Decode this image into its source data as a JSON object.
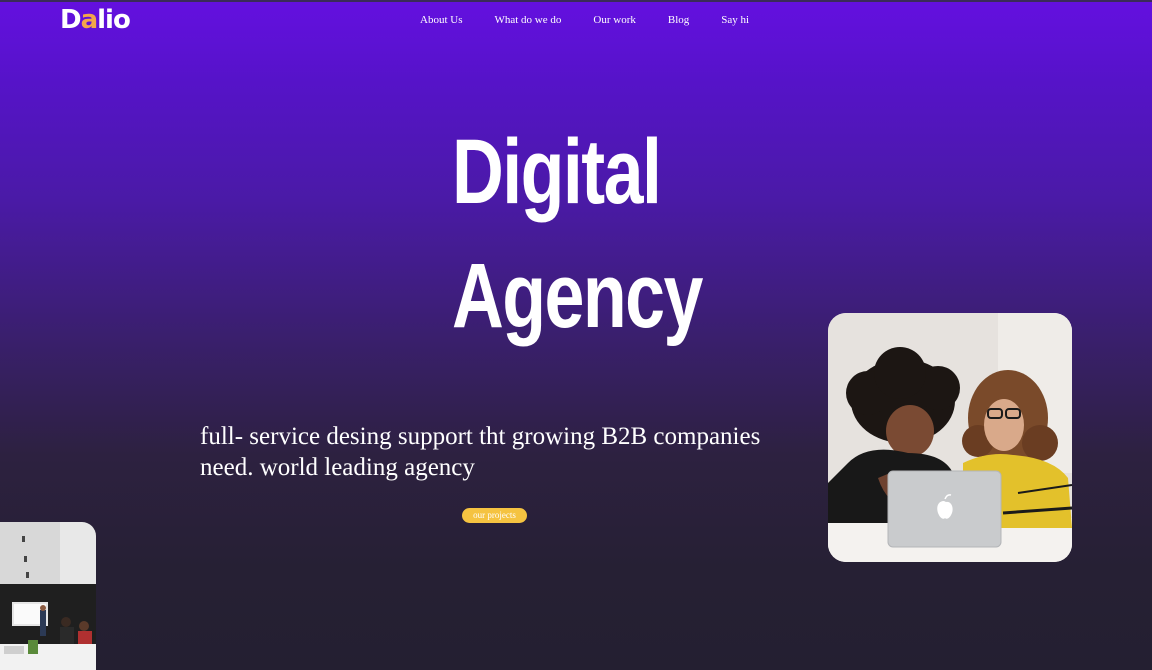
{
  "brand": {
    "logo_d": "D",
    "logo_a": "a",
    "logo_rest": "lio",
    "accent_color": "#f3a64a"
  },
  "nav": {
    "items": [
      {
        "label": "About Us"
      },
      {
        "label": "What do we do"
      },
      {
        "label": "Our work"
      },
      {
        "label": "Blog"
      },
      {
        "label": "Say hi"
      }
    ]
  },
  "hero": {
    "title_line1": "Digital",
    "title_line2": "Agency",
    "tagline": "full- service desing support tht growing B2B companies need. world leading agency",
    "cta_label": "our projects",
    "cta_color": "#f5c341"
  },
  "images": {
    "right_photo": "two-women-laptop-photo",
    "left_photo": "office-workspace-photo"
  },
  "colors": {
    "gradient_top": "#6410e0",
    "gradient_bottom": "#241f31"
  }
}
